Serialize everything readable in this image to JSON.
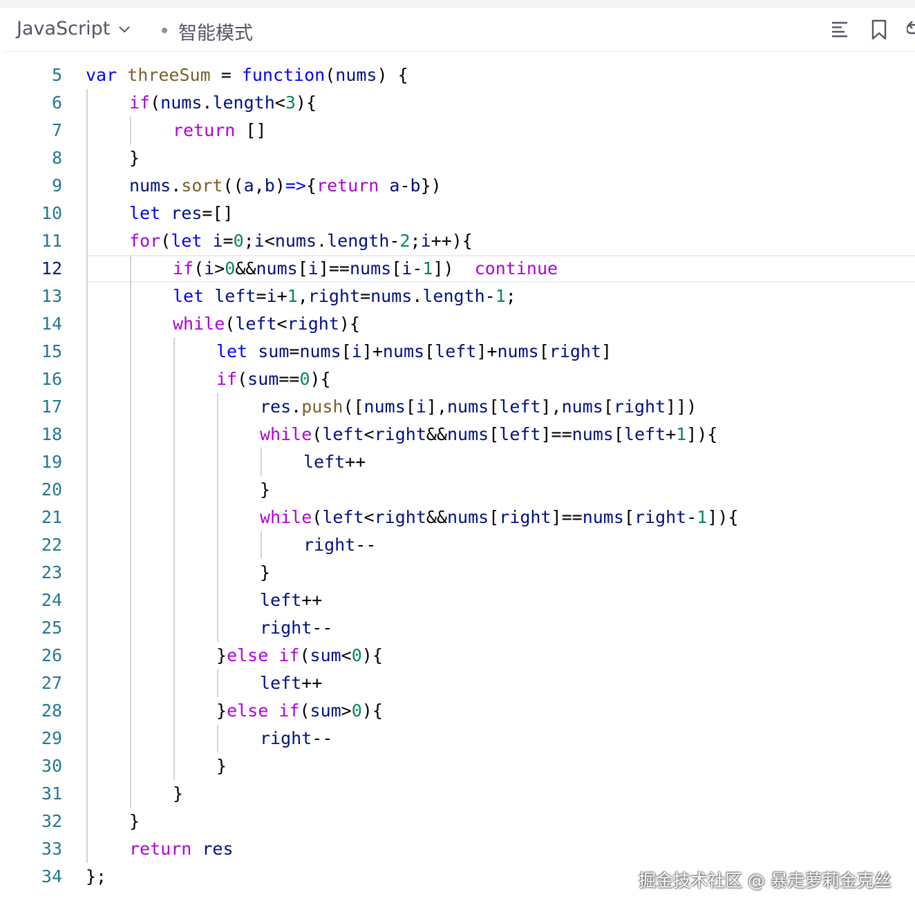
{
  "toolbar": {
    "language": "JavaScript",
    "mode": "智能模式"
  },
  "icons": {
    "language_dropdown": "chevron-down-icon",
    "outline": "list-icon",
    "bookmark": "bookmark-icon",
    "undo": "undo-icon"
  },
  "colors": {
    "keyword": "#0000ff",
    "control": "#af00db",
    "function": "#795e26",
    "number": "#098658",
    "variable": "#001080",
    "line_number": "#237893"
  },
  "editor": {
    "active_line": 12,
    "lines": [
      {
        "n": "5",
        "indent": 0,
        "tokens": [
          [
            "kw",
            "var"
          ],
          [
            "txt",
            " "
          ],
          [
            "fn",
            "threeSum"
          ],
          [
            "txt",
            " = "
          ],
          [
            "kw",
            "function"
          ],
          [
            "txt",
            "("
          ],
          [
            "var",
            "nums"
          ],
          [
            "txt",
            ") {"
          ]
        ]
      },
      {
        "n": "6",
        "indent": 1,
        "tokens": [
          [
            "ctl",
            "if"
          ],
          [
            "txt",
            "("
          ],
          [
            "var",
            "nums"
          ],
          [
            "txt",
            "."
          ],
          [
            "var",
            "length"
          ],
          [
            "txt",
            "<"
          ],
          [
            "num",
            "3"
          ],
          [
            "txt",
            "){"
          ]
        ]
      },
      {
        "n": "7",
        "indent": 2,
        "tokens": [
          [
            "ctl",
            "return"
          ],
          [
            "txt",
            " []"
          ]
        ]
      },
      {
        "n": "8",
        "indent": 1,
        "tokens": [
          [
            "txt",
            "}"
          ]
        ]
      },
      {
        "n": "9",
        "indent": 1,
        "tokens": [
          [
            "var",
            "nums"
          ],
          [
            "txt",
            "."
          ],
          [
            "fn",
            "sort"
          ],
          [
            "txt",
            "(("
          ],
          [
            "var",
            "a"
          ],
          [
            "txt",
            ","
          ],
          [
            "var",
            "b"
          ],
          [
            "txt",
            ")"
          ],
          [
            "kw",
            "=>"
          ],
          [
            "txt",
            "{"
          ],
          [
            "ctl",
            "return"
          ],
          [
            "txt",
            " "
          ],
          [
            "var",
            "a"
          ],
          [
            "txt",
            "-"
          ],
          [
            "var",
            "b"
          ],
          [
            "txt",
            "})"
          ]
        ]
      },
      {
        "n": "10",
        "indent": 1,
        "tokens": [
          [
            "kw",
            "let"
          ],
          [
            "txt",
            " "
          ],
          [
            "var",
            "res"
          ],
          [
            "txt",
            "=[]"
          ]
        ]
      },
      {
        "n": "11",
        "indent": 1,
        "tokens": [
          [
            "ctl",
            "for"
          ],
          [
            "txt",
            "("
          ],
          [
            "kw",
            "let"
          ],
          [
            "txt",
            " "
          ],
          [
            "var",
            "i"
          ],
          [
            "txt",
            "="
          ],
          [
            "num",
            "0"
          ],
          [
            "txt",
            ";"
          ],
          [
            "var",
            "i"
          ],
          [
            "txt",
            "<"
          ],
          [
            "var",
            "nums"
          ],
          [
            "txt",
            "."
          ],
          [
            "var",
            "length"
          ],
          [
            "txt",
            "-"
          ],
          [
            "num",
            "2"
          ],
          [
            "txt",
            ";"
          ],
          [
            "var",
            "i"
          ],
          [
            "txt",
            "++){"
          ]
        ]
      },
      {
        "n": "12",
        "indent": 2,
        "tokens": [
          [
            "ctl",
            "if"
          ],
          [
            "txt",
            "("
          ],
          [
            "var",
            "i"
          ],
          [
            "txt",
            ">"
          ],
          [
            "num",
            "0"
          ],
          [
            "txt",
            "&&"
          ],
          [
            "var",
            "nums"
          ],
          [
            "txt",
            "["
          ],
          [
            "var",
            "i"
          ],
          [
            "txt",
            "]=="
          ],
          [
            "var",
            "nums"
          ],
          [
            "txt",
            "["
          ],
          [
            "var",
            "i"
          ],
          [
            "txt",
            "-"
          ],
          [
            "num",
            "1"
          ],
          [
            "txt",
            "])  "
          ],
          [
            "ctl",
            "continue"
          ]
        ]
      },
      {
        "n": "13",
        "indent": 2,
        "tokens": [
          [
            "kw",
            "let"
          ],
          [
            "txt",
            " "
          ],
          [
            "var",
            "left"
          ],
          [
            "txt",
            "="
          ],
          [
            "var",
            "i"
          ],
          [
            "txt",
            "+"
          ],
          [
            "num",
            "1"
          ],
          [
            "txt",
            ","
          ],
          [
            "var",
            "right"
          ],
          [
            "txt",
            "="
          ],
          [
            "var",
            "nums"
          ],
          [
            "txt",
            "."
          ],
          [
            "var",
            "length"
          ],
          [
            "txt",
            "-"
          ],
          [
            "num",
            "1"
          ],
          [
            "txt",
            ";"
          ]
        ]
      },
      {
        "n": "14",
        "indent": 2,
        "tokens": [
          [
            "ctl",
            "while"
          ],
          [
            "txt",
            "("
          ],
          [
            "var",
            "left"
          ],
          [
            "txt",
            "<"
          ],
          [
            "var",
            "right"
          ],
          [
            "txt",
            "){"
          ]
        ]
      },
      {
        "n": "15",
        "indent": 3,
        "tokens": [
          [
            "kw",
            "let"
          ],
          [
            "txt",
            " "
          ],
          [
            "var",
            "sum"
          ],
          [
            "txt",
            "="
          ],
          [
            "var",
            "nums"
          ],
          [
            "txt",
            "["
          ],
          [
            "var",
            "i"
          ],
          [
            "txt",
            "]+"
          ],
          [
            "var",
            "nums"
          ],
          [
            "txt",
            "["
          ],
          [
            "var",
            "left"
          ],
          [
            "txt",
            "]+"
          ],
          [
            "var",
            "nums"
          ],
          [
            "txt",
            "["
          ],
          [
            "var",
            "right"
          ],
          [
            "txt",
            "]"
          ]
        ]
      },
      {
        "n": "16",
        "indent": 3,
        "tokens": [
          [
            "ctl",
            "if"
          ],
          [
            "txt",
            "("
          ],
          [
            "var",
            "sum"
          ],
          [
            "txt",
            "=="
          ],
          [
            "num",
            "0"
          ],
          [
            "txt",
            "){"
          ]
        ]
      },
      {
        "n": "17",
        "indent": 4,
        "tokens": [
          [
            "var",
            "res"
          ],
          [
            "txt",
            "."
          ],
          [
            "fn",
            "push"
          ],
          [
            "txt",
            "(["
          ],
          [
            "var",
            "nums"
          ],
          [
            "txt",
            "["
          ],
          [
            "var",
            "i"
          ],
          [
            "txt",
            "],"
          ],
          [
            "var",
            "nums"
          ],
          [
            "txt",
            "["
          ],
          [
            "var",
            "left"
          ],
          [
            "txt",
            "],"
          ],
          [
            "var",
            "nums"
          ],
          [
            "txt",
            "["
          ],
          [
            "var",
            "right"
          ],
          [
            "txt",
            "]])"
          ]
        ]
      },
      {
        "n": "18",
        "indent": 4,
        "tokens": [
          [
            "ctl",
            "while"
          ],
          [
            "txt",
            "("
          ],
          [
            "var",
            "left"
          ],
          [
            "txt",
            "<"
          ],
          [
            "var",
            "right"
          ],
          [
            "txt",
            "&&"
          ],
          [
            "var",
            "nums"
          ],
          [
            "txt",
            "["
          ],
          [
            "var",
            "left"
          ],
          [
            "txt",
            "]=="
          ],
          [
            "var",
            "nums"
          ],
          [
            "txt",
            "["
          ],
          [
            "var",
            "left"
          ],
          [
            "txt",
            "+"
          ],
          [
            "num",
            "1"
          ],
          [
            "txt",
            "]){"
          ]
        ]
      },
      {
        "n": "19",
        "indent": 5,
        "tokens": [
          [
            "var",
            "left"
          ],
          [
            "txt",
            "++"
          ]
        ]
      },
      {
        "n": "20",
        "indent": 4,
        "tokens": [
          [
            "txt",
            "}"
          ]
        ]
      },
      {
        "n": "21",
        "indent": 4,
        "tokens": [
          [
            "ctl",
            "while"
          ],
          [
            "txt",
            "("
          ],
          [
            "var",
            "left"
          ],
          [
            "txt",
            "<"
          ],
          [
            "var",
            "right"
          ],
          [
            "txt",
            "&&"
          ],
          [
            "var",
            "nums"
          ],
          [
            "txt",
            "["
          ],
          [
            "var",
            "right"
          ],
          [
            "txt",
            "]=="
          ],
          [
            "var",
            "nums"
          ],
          [
            "txt",
            "["
          ],
          [
            "var",
            "right"
          ],
          [
            "txt",
            "-"
          ],
          [
            "num",
            "1"
          ],
          [
            "txt",
            "]){"
          ]
        ]
      },
      {
        "n": "22",
        "indent": 5,
        "tokens": [
          [
            "var",
            "right"
          ],
          [
            "txt",
            "--"
          ]
        ]
      },
      {
        "n": "23",
        "indent": 4,
        "tokens": [
          [
            "txt",
            "}"
          ]
        ]
      },
      {
        "n": "24",
        "indent": 4,
        "tokens": [
          [
            "var",
            "left"
          ],
          [
            "txt",
            "++"
          ]
        ]
      },
      {
        "n": "25",
        "indent": 4,
        "tokens": [
          [
            "var",
            "right"
          ],
          [
            "txt",
            "--"
          ]
        ]
      },
      {
        "n": "26",
        "indent": 3,
        "tokens": [
          [
            "txt",
            "}"
          ],
          [
            "ctl",
            "else"
          ],
          [
            "txt",
            " "
          ],
          [
            "ctl",
            "if"
          ],
          [
            "txt",
            "("
          ],
          [
            "var",
            "sum"
          ],
          [
            "txt",
            "<"
          ],
          [
            "num",
            "0"
          ],
          [
            "txt",
            "){"
          ]
        ]
      },
      {
        "n": "27",
        "indent": 4,
        "tokens": [
          [
            "var",
            "left"
          ],
          [
            "txt",
            "++"
          ]
        ]
      },
      {
        "n": "28",
        "indent": 3,
        "tokens": [
          [
            "txt",
            "}"
          ],
          [
            "ctl",
            "else"
          ],
          [
            "txt",
            " "
          ],
          [
            "ctl",
            "if"
          ],
          [
            "txt",
            "("
          ],
          [
            "var",
            "sum"
          ],
          [
            "txt",
            ">"
          ],
          [
            "num",
            "0"
          ],
          [
            "txt",
            "){"
          ]
        ]
      },
      {
        "n": "29",
        "indent": 4,
        "tokens": [
          [
            "var",
            "right"
          ],
          [
            "txt",
            "--"
          ]
        ]
      },
      {
        "n": "30",
        "indent": 3,
        "tokens": [
          [
            "txt",
            "}"
          ]
        ]
      },
      {
        "n": "31",
        "indent": 2,
        "tokens": [
          [
            "txt",
            "}"
          ]
        ]
      },
      {
        "n": "32",
        "indent": 1,
        "tokens": [
          [
            "txt",
            "}"
          ]
        ]
      },
      {
        "n": "33",
        "indent": 1,
        "tokens": [
          [
            "ctl",
            "return"
          ],
          [
            "txt",
            " "
          ],
          [
            "var",
            "res"
          ]
        ]
      },
      {
        "n": "34",
        "indent": 0,
        "tokens": [
          [
            "txt",
            "};"
          ]
        ]
      }
    ]
  },
  "watermark": "掘金技术社区 @ 暴走萝莉金克丝"
}
